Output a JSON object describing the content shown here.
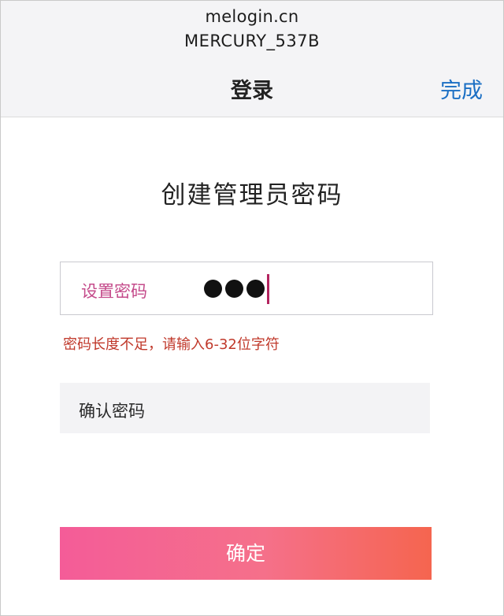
{
  "header": {
    "url": "melogin.cn",
    "ssid": "MERCURY_537B",
    "title": "登录",
    "done_label": "完成"
  },
  "main": {
    "title": "创建管理员密码",
    "password_field": {
      "label": "设置密码",
      "masked_length": 3
    },
    "error_text": "密码长度不足，请输入6-32位字符",
    "confirm_field": {
      "placeholder": "确认密码"
    },
    "submit_label": "确定"
  },
  "colors": {
    "link": "#1b6fc4",
    "error": "#c0392b",
    "button_gradient_start": "#f45c98",
    "button_gradient_end": "#f5654f"
  }
}
